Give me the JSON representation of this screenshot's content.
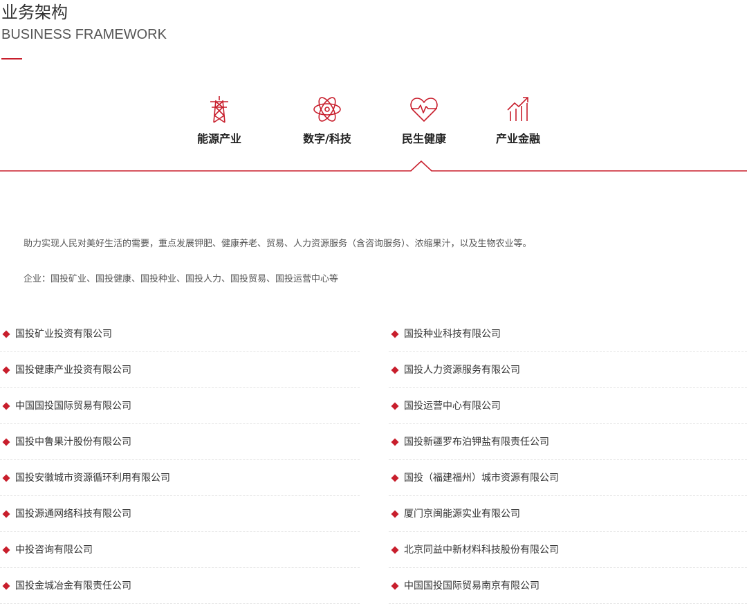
{
  "header": {
    "title_zh": "业务架构",
    "title_en": "BUSINESS FRAMEWORK"
  },
  "colors": {
    "accent": "#c81e2c",
    "text": "#333333"
  },
  "tabs": [
    {
      "label": "能源产业",
      "icon": "power-tower-icon",
      "active": false
    },
    {
      "label": "数字/科技",
      "icon": "atom-icon",
      "active": false
    },
    {
      "label": "民生健康",
      "icon": "heart-pulse-icon",
      "active": true
    },
    {
      "label": "产业金融",
      "icon": "growth-chart-icon",
      "active": false
    }
  ],
  "description": {
    "line1": "助力实现人民对美好生活的需要，重点发展钾肥、健康养老、贸易、人力资源服务（含咨询服务）、浓缩果汁，以及生物农业等。",
    "line2": "企业：国投矿业、国投健康、国投种业、国投人力、国投贸易、国投运营中心等"
  },
  "companies_left": [
    "国投矿业投资有限公司",
    "国投健康产业投资有限公司",
    "中国国投国际贸易有限公司",
    "国投中鲁果汁股份有限公司",
    "国投安徽城市资源循环利用有限公司",
    "国投源通网络科技有限公司",
    "中投咨询有限公司",
    "国投金城冶金有限责任公司"
  ],
  "companies_right": [
    "国投种业科技有限公司",
    "国投人力资源服务有限公司",
    "国投运营中心有限公司",
    "国投新疆罗布泊钾盐有限责任公司",
    "国投（福建福州）城市资源有限公司",
    "厦门京闽能源实业有限公司",
    "北京同益中新材料科技股份有限公司",
    "中国国投国际贸易南京有限公司"
  ]
}
